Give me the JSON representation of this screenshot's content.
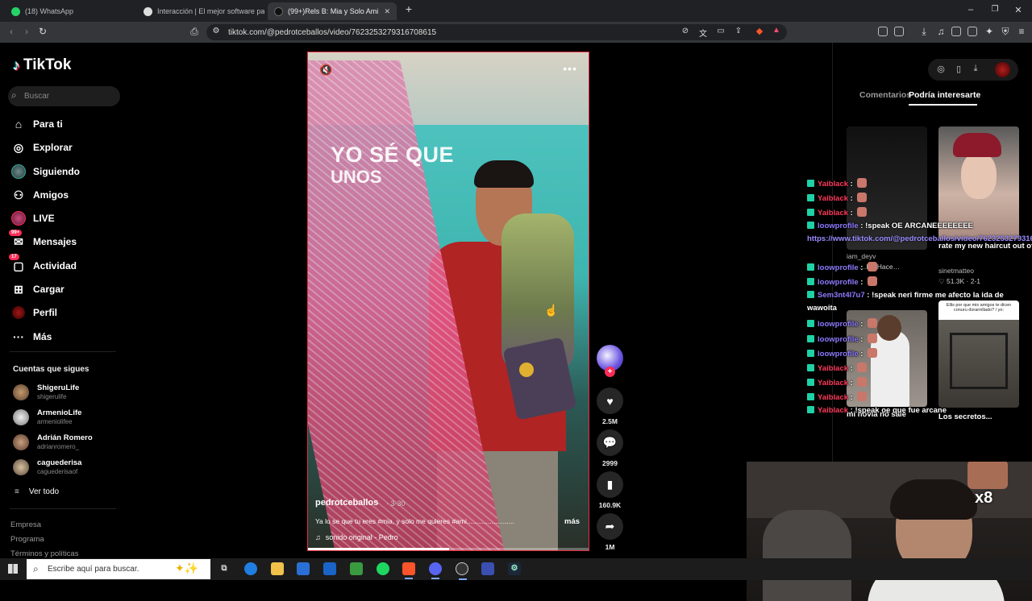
{
  "browser": {
    "tabs": [
      {
        "title": "(18) WhatsApp",
        "active": false
      },
      {
        "title": "Interacción | El mejor software pa",
        "active": false
      },
      {
        "title": "(99+)Rels B: Mia y Solo Ami (Can",
        "active": true
      }
    ],
    "new_tab": "+",
    "window_controls": [
      "–",
      "❐",
      "✕"
    ],
    "url": "tiktok.com/@pedrotceballos/video/7623253279316708615"
  },
  "tiktok": {
    "logo": "TikTok",
    "search_placeholder": "Buscar",
    "nav": [
      {
        "label": "Para ti",
        "icon": "home-icon"
      },
      {
        "label": "Explorar",
        "icon": "compass-icon"
      },
      {
        "label": "Siguiendo",
        "icon": "following-avatar-icon"
      },
      {
        "label": "Amigos",
        "icon": "friends-icon"
      },
      {
        "label": "LIVE",
        "icon": "live-icon"
      },
      {
        "label": "Mensajes",
        "icon": "messages-icon",
        "badge": "99+"
      },
      {
        "label": "Actividad",
        "icon": "activity-icon",
        "badge": "17"
      },
      {
        "label": "Cargar",
        "icon": "upload-icon"
      },
      {
        "label": "Perfil",
        "icon": "profile-icon"
      },
      {
        "label": "Más",
        "icon": "more-icon"
      }
    ],
    "following_title": "Cuentas que sigues",
    "following": [
      {
        "name": "ShigeruLife",
        "handle": "shigerulife"
      },
      {
        "name": "ArmenioLife",
        "handle": "armeniolifee"
      },
      {
        "name": "Adrián Romero",
        "handle": "adrianromero_"
      },
      {
        "name": "caguederisa",
        "handle": "caguederisaof"
      }
    ],
    "see_all": "Ver todo",
    "footer": [
      "Empresa",
      "Programa",
      "Términos y políticas"
    ]
  },
  "video": {
    "overlay_line1": "YO SÉ QUE",
    "overlay_line2": "UNOS",
    "author": "pedrotceballos",
    "date": "· 3-30",
    "caption": "Ya lo se que tu eres #mia, y solo me quieres #ami.........................",
    "more": "más",
    "sound": "sonido original - Pedro",
    "progress": 0.5
  },
  "actions": {
    "likes": "2.5M",
    "comments": "2999",
    "saves": "160.9K",
    "shares": "1M"
  },
  "right_panel": {
    "tabs": [
      "Comentarios",
      "Podría interesarte"
    ],
    "active_tab": "Podría interesarte",
    "thumbs": [
      {
        "caption": "",
        "author": "iam_deyv",
        "stats": "…K · Hace…"
      },
      {
        "caption": "rate my new haircut out of 10...",
        "author": "sinetmatteo",
        "stats": "51.3K · 2-1"
      },
      {
        "caption": "mi novia no sale",
        "author": "",
        "stats": ""
      },
      {
        "caption": "Los secretos...",
        "author": "",
        "stats": "",
        "thumb_text": "Ellis por que mis amigos te dicen conuru dorarnillado? / yo:"
      }
    ]
  },
  "chat": {
    "lines": [
      {
        "user": "Yaiblack",
        "msg": "",
        "color": "#ff3b5c",
        "emote": true
      },
      {
        "user": "Yaiblack",
        "msg": "",
        "color": "#ff3b5c",
        "emote": true
      },
      {
        "user": "Yaiblack",
        "msg": "",
        "color": "#ff3b5c",
        "emote": true
      },
      {
        "user": "loowprofile",
        "msg": "!speak OE ARCANEEEEEEEE",
        "color": "#8d7bff",
        "emote": false
      },
      {
        "user": "loowprofile",
        "msg": "",
        "color": "#8d7bff",
        "emote": true
      },
      {
        "user": "loowprofile",
        "msg": "",
        "color": "#8d7bff",
        "emote": true
      },
      {
        "user": "Sem3nt4l7u7",
        "msg": "!speak neri firme me afecto la ida de",
        "color": "#8d7bff",
        "emote": false
      },
      {
        "user": "",
        "msg": "wawoita",
        "color": "#fff",
        "emote": false
      },
      {
        "user": "loowprofile",
        "msg": "",
        "color": "#8d7bff",
        "emote": true
      },
      {
        "user": "loowprofile",
        "msg": "",
        "color": "#8d7bff",
        "emote": true
      },
      {
        "user": "loowprofile",
        "msg": "",
        "color": "#8d7bff",
        "emote": true
      },
      {
        "user": "Yaiblack",
        "msg": "",
        "color": "#ff3b5c",
        "emote": true
      },
      {
        "user": "Yaiblack",
        "msg": "",
        "color": "#ff3b5c",
        "emote": true
      },
      {
        "user": "Yaiblack",
        "msg": "",
        "color": "#ff3b5c",
        "emote": true
      },
      {
        "user": "Yaiblack",
        "msg": "!speak oe que fue arcane",
        "color": "#ff3b5c",
        "emote": false
      }
    ],
    "link": "https://www.tiktok.com/@pedrotceballos/video/7623253279316708615"
  },
  "cam": {
    "multiplier": "x8"
  },
  "taskbar": {
    "search_placeholder": "Escribe aquí para buscar."
  }
}
